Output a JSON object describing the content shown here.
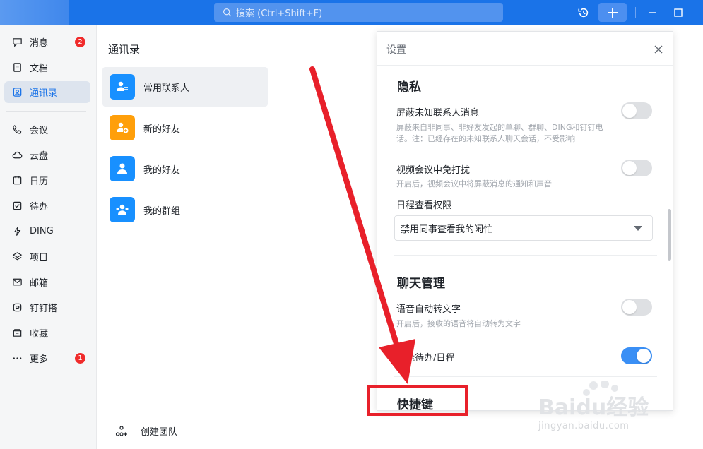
{
  "titlebar": {
    "search_placeholder": "搜索 (Ctrl+Shift+F)",
    "icons": [
      "history-icon",
      "plus-icon",
      "minimize-icon",
      "maximize-icon"
    ]
  },
  "nav": {
    "items": [
      {
        "label": "消息",
        "icon": "message-icon",
        "badge": "2"
      },
      {
        "label": "文档",
        "icon": "document-icon"
      },
      {
        "label": "通讯录",
        "icon": "contacts-icon",
        "active": true
      },
      {
        "label": "会议",
        "icon": "phone-icon"
      },
      {
        "label": "云盘",
        "icon": "cloud-icon"
      },
      {
        "label": "日历",
        "icon": "calendar-icon"
      },
      {
        "label": "待办",
        "icon": "todo-icon"
      },
      {
        "label": "DING",
        "icon": "ding-icon"
      },
      {
        "label": "项目",
        "icon": "project-icon"
      },
      {
        "label": "邮箱",
        "icon": "mail-icon"
      },
      {
        "label": "钉钉搭",
        "icon": "build-icon"
      },
      {
        "label": "收藏",
        "icon": "favorite-icon"
      },
      {
        "label": "更多",
        "icon": "more-icon",
        "badge": "1"
      }
    ]
  },
  "contacts": {
    "title": "通讯录",
    "items": [
      {
        "label": "常用联系人",
        "color": "#1890ff"
      },
      {
        "label": "新的好友",
        "color": "#ff9f0a"
      },
      {
        "label": "我的好友",
        "color": "#1890ff"
      },
      {
        "label": "我的群组",
        "color": "#1890ff"
      }
    ],
    "footer": "创建团队"
  },
  "settings": {
    "title": "设置",
    "privacy": {
      "heading": "隐私",
      "block_unknown": {
        "label": "屏蔽未知联系人消息",
        "desc": "屏蔽来自非同事、非好友发起的单聊、群聊、DING和钉钉电话。注：已经存在的未知联系人聊天会话，不受影响",
        "on": false
      },
      "meeting_dnd": {
        "label": "视频会议中免打扰",
        "desc": "开启后，视频会议中将屏蔽消息的通知和声音",
        "on": false
      },
      "calendar_permission": {
        "label": "日程查看权限",
        "value": "禁用同事查看我的闲忙"
      }
    },
    "chat": {
      "heading": "聊天管理",
      "voice_to_text": {
        "label": "语音自动转文字",
        "desc": "开启后，接收的语音将自动转为文字",
        "on": true
      },
      "smart_todo": {
        "label": "能待办/日程",
        "on": true
      }
    },
    "shortcut_heading": "快捷键"
  },
  "watermark": {
    "main": "Baidu经验",
    "sub": "jingyan.baidu.com"
  },
  "colors": {
    "accent": "#1a73e8",
    "annotation": "#e8202a"
  }
}
